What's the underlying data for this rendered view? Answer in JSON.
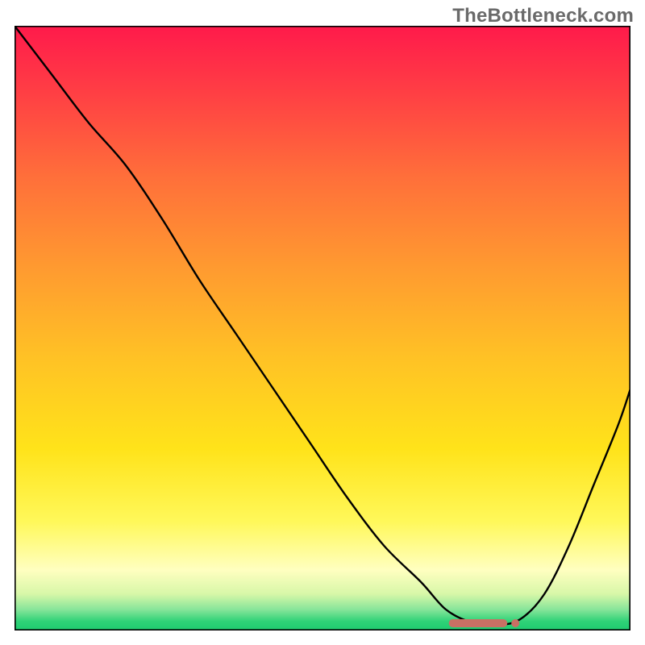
{
  "watermark": "TheBottleneck.com",
  "chart_data": {
    "type": "line",
    "title": "",
    "xlabel": "",
    "ylabel": "",
    "xlim": [
      0,
      100
    ],
    "ylim": [
      0,
      100
    ],
    "grid": false,
    "legend": false,
    "background": {
      "type": "vertical-gradient",
      "stops": [
        {
          "pos": 0.0,
          "color": "#ff1a4b"
        },
        {
          "pos": 0.1,
          "color": "#ff3b45"
        },
        {
          "pos": 0.25,
          "color": "#ff6f3a"
        },
        {
          "pos": 0.4,
          "color": "#ff9a30"
        },
        {
          "pos": 0.55,
          "color": "#ffc225"
        },
        {
          "pos": 0.7,
          "color": "#ffe31a"
        },
        {
          "pos": 0.82,
          "color": "#fff85a"
        },
        {
          "pos": 0.9,
          "color": "#ffffc0"
        },
        {
          "pos": 0.94,
          "color": "#d7f7a8"
        },
        {
          "pos": 0.965,
          "color": "#88e59a"
        },
        {
          "pos": 0.985,
          "color": "#2fd277"
        },
        {
          "pos": 1.0,
          "color": "#1ecb6f"
        }
      ]
    },
    "series": [
      {
        "name": "curve",
        "color": "#000000",
        "width": 2.4,
        "x": [
          0,
          6,
          12,
          18,
          24,
          30,
          36,
          42,
          48,
          54,
          60,
          66,
          70,
          74,
          78,
          82,
          86,
          90,
          94,
          98,
          100
        ],
        "y": [
          100,
          92,
          84,
          77,
          68,
          58,
          49,
          40,
          31,
          22,
          14,
          8,
          3.5,
          1.4,
          0.9,
          1.8,
          6,
          14,
          24,
          34,
          40
        ]
      }
    ],
    "markers": {
      "name": "minimum-band",
      "color": "#c97064",
      "shape": "rounded-dash",
      "x_range": [
        70.5,
        80
      ],
      "y": 1.2
    }
  }
}
